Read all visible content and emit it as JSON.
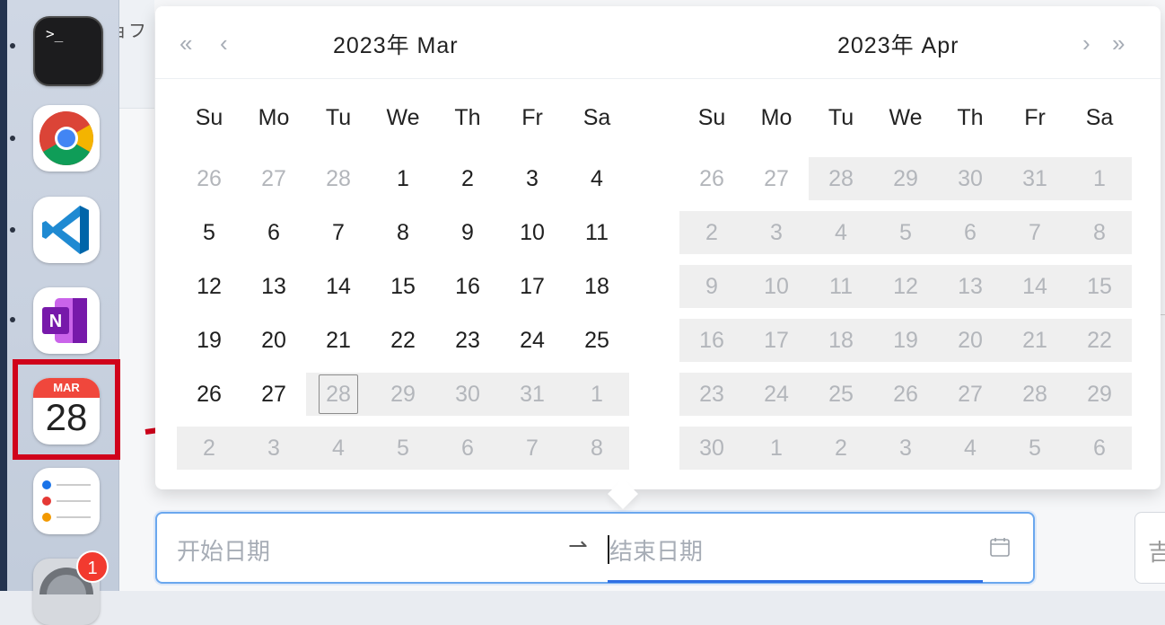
{
  "background": {
    "partial_text": "ョフ"
  },
  "dock": {
    "apps": [
      {
        "name": "Terminal",
        "icon": "terminal-icon",
        "glyph": ">_"
      },
      {
        "name": "Google Chrome",
        "icon": "chrome-icon"
      },
      {
        "name": "Visual Studio Code",
        "icon": "vscode-icon"
      },
      {
        "name": "OneNote",
        "icon": "onenote-icon",
        "glyph": "N"
      },
      {
        "name": "Calendar",
        "icon": "calendar-icon",
        "month": "MAR",
        "day": "28"
      },
      {
        "name": "Reminders",
        "icon": "reminders-icon"
      },
      {
        "name": "System Settings",
        "icon": "settings-icon",
        "badge": "1"
      }
    ]
  },
  "picker": {
    "nav": {
      "prev_year": "«",
      "prev_month": "‹",
      "next_month": "›",
      "next_year": "»"
    },
    "left": {
      "title": "2023年  Mar",
      "weekdays": [
        "Su",
        "Mo",
        "Tu",
        "We",
        "Th",
        "Fr",
        "Sa"
      ],
      "rows": [
        [
          [
            "26",
            "out"
          ],
          [
            "27",
            "out"
          ],
          [
            "28",
            "out"
          ],
          [
            "1",
            "in"
          ],
          [
            "2",
            "in"
          ],
          [
            "3",
            "in"
          ],
          [
            "4",
            "in"
          ]
        ],
        [
          [
            "5",
            "in"
          ],
          [
            "6",
            "in"
          ],
          [
            "7",
            "in"
          ],
          [
            "8",
            "in"
          ],
          [
            "9",
            "in"
          ],
          [
            "10",
            "in"
          ],
          [
            "11",
            "in"
          ]
        ],
        [
          [
            "12",
            "in"
          ],
          [
            "13",
            "in"
          ],
          [
            "14",
            "in"
          ],
          [
            "15",
            "in"
          ],
          [
            "16",
            "in"
          ],
          [
            "17",
            "in"
          ],
          [
            "18",
            "in"
          ]
        ],
        [
          [
            "19",
            "in"
          ],
          [
            "20",
            "in"
          ],
          [
            "21",
            "in"
          ],
          [
            "22",
            "in"
          ],
          [
            "23",
            "in"
          ],
          [
            "24",
            "in"
          ],
          [
            "25",
            "in"
          ]
        ],
        [
          [
            "26",
            "in"
          ],
          [
            "27",
            "in"
          ],
          [
            "28",
            "today"
          ],
          [
            "29",
            "dis"
          ],
          [
            "30",
            "dis"
          ],
          [
            "31",
            "dis"
          ],
          [
            "1",
            "dis"
          ]
        ],
        [
          [
            "2",
            "dis"
          ],
          [
            "3",
            "dis"
          ],
          [
            "4",
            "dis"
          ],
          [
            "5",
            "dis"
          ],
          [
            "6",
            "dis"
          ],
          [
            "7",
            "dis"
          ],
          [
            "8",
            "dis"
          ]
        ]
      ]
    },
    "right": {
      "title": "2023年  Apr",
      "weekdays": [
        "Su",
        "Mo",
        "Tu",
        "We",
        "Th",
        "Fr",
        "Sa"
      ],
      "rows": [
        [
          [
            "26",
            "out"
          ],
          [
            "27",
            "out"
          ],
          [
            "28",
            "dis"
          ],
          [
            "29",
            "dis"
          ],
          [
            "30",
            "dis"
          ],
          [
            "31",
            "dis"
          ],
          [
            "1",
            "dis"
          ]
        ],
        [
          [
            "2",
            "dis"
          ],
          [
            "3",
            "dis"
          ],
          [
            "4",
            "dis"
          ],
          [
            "5",
            "dis"
          ],
          [
            "6",
            "dis"
          ],
          [
            "7",
            "dis"
          ],
          [
            "8",
            "dis"
          ]
        ],
        [
          [
            "9",
            "dis"
          ],
          [
            "10",
            "dis"
          ],
          [
            "11",
            "dis"
          ],
          [
            "12",
            "dis"
          ],
          [
            "13",
            "dis"
          ],
          [
            "14",
            "dis"
          ],
          [
            "15",
            "dis"
          ]
        ],
        [
          [
            "16",
            "dis"
          ],
          [
            "17",
            "dis"
          ],
          [
            "18",
            "dis"
          ],
          [
            "19",
            "dis"
          ],
          [
            "20",
            "dis"
          ],
          [
            "21",
            "dis"
          ],
          [
            "22",
            "dis"
          ]
        ],
        [
          [
            "23",
            "dis"
          ],
          [
            "24",
            "dis"
          ],
          [
            "25",
            "dis"
          ],
          [
            "26",
            "dis"
          ],
          [
            "27",
            "dis"
          ],
          [
            "28",
            "dis"
          ],
          [
            "29",
            "dis"
          ]
        ],
        [
          [
            "30",
            "dis"
          ],
          [
            "1",
            "dis"
          ],
          [
            "2",
            "dis"
          ],
          [
            "3",
            "dis"
          ],
          [
            "4",
            "dis"
          ],
          [
            "5",
            "dis"
          ],
          [
            "6",
            "dis"
          ]
        ]
      ]
    }
  },
  "range_input": {
    "start_placeholder": "开始日期",
    "separator": "⇀",
    "end_placeholder": "结束日期",
    "icon": "calendar-icon"
  },
  "side_button": {
    "partial_text": "吉"
  },
  "colors": {
    "accent": "#2f6fe3",
    "annotation_red": "#d0021b",
    "disabled_bg": "#efefef"
  }
}
